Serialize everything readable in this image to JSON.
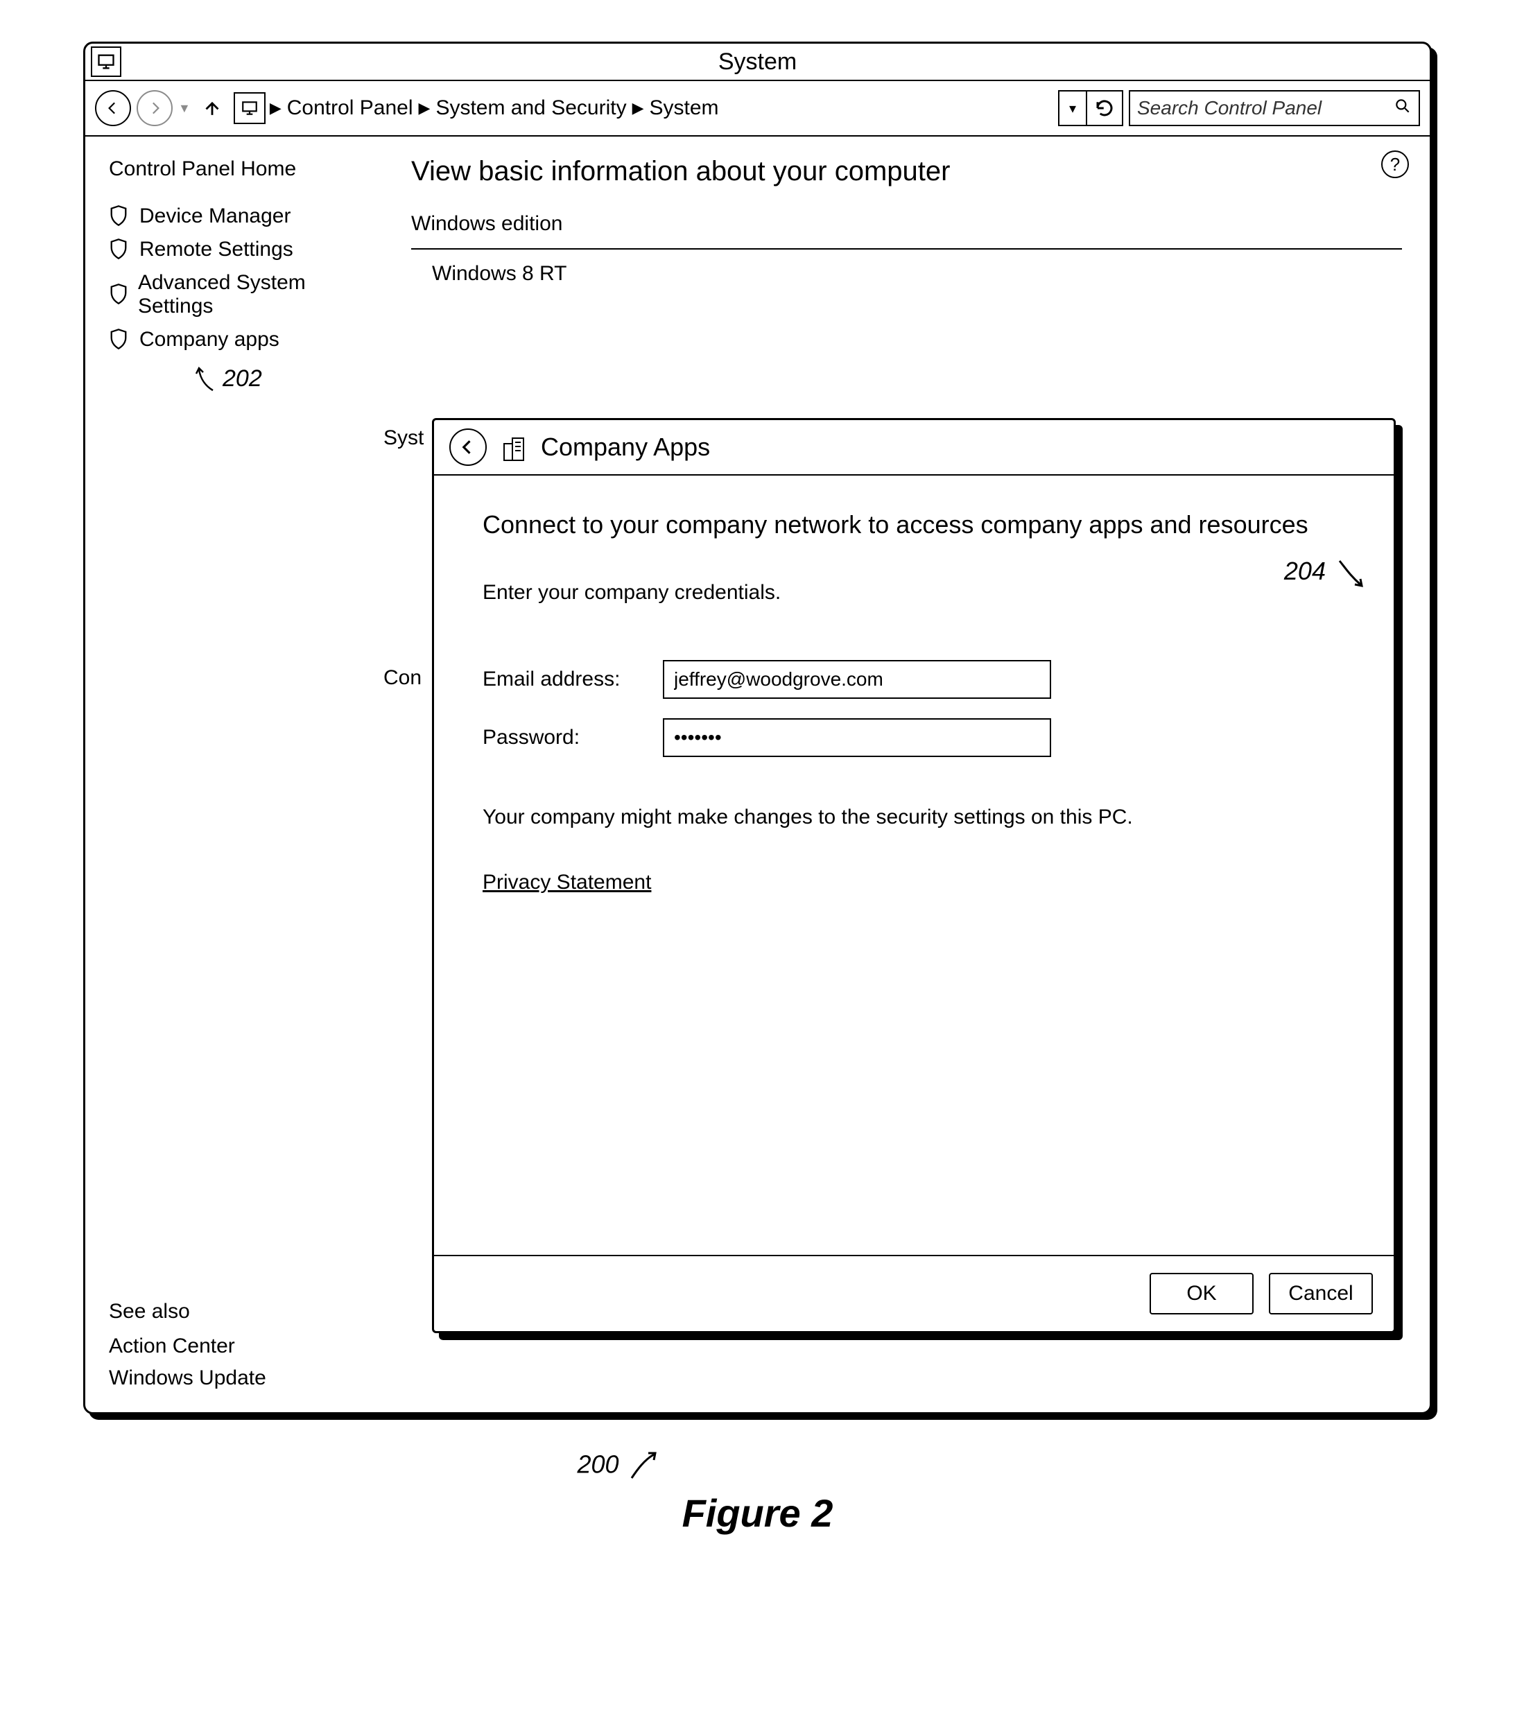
{
  "window": {
    "title": "System"
  },
  "toolbar": {
    "breadcrumb": [
      "Control Panel",
      "System and Security",
      "System"
    ],
    "search_placeholder": "Search Control Panel"
  },
  "sidebar": {
    "home": "Control Panel Home",
    "items": [
      {
        "label": "Device Manager"
      },
      {
        "label": "Remote Settings"
      },
      {
        "label": "Advanced System Settings"
      },
      {
        "label": "Company apps"
      }
    ],
    "see_also_title": "See also",
    "see_also": [
      "Action Center",
      "Windows Update"
    ]
  },
  "main": {
    "heading": "View basic information about your computer",
    "edition_label": "Windows edition",
    "edition_value": "Windows 8 RT",
    "fragment_syst": "Syst",
    "fragment_con": "Con",
    "help_tooltip": "?"
  },
  "dialog": {
    "title": "Company Apps",
    "heading": "Connect to your company network to access company apps and resources",
    "subheading": "Enter your company credentials.",
    "email_label": "Email address:",
    "email_value": "jeffrey@woodgrove.com",
    "password_label": "Password:",
    "password_value": "•••••••",
    "note": "Your company might make changes to the security settings on this PC.",
    "privacy_link": "Privacy Statement",
    "ok_label": "OK",
    "cancel_label": "Cancel"
  },
  "annotations": {
    "ref_200": "200",
    "ref_202": "202",
    "ref_204": "204",
    "figure_label": "Figure 2"
  }
}
